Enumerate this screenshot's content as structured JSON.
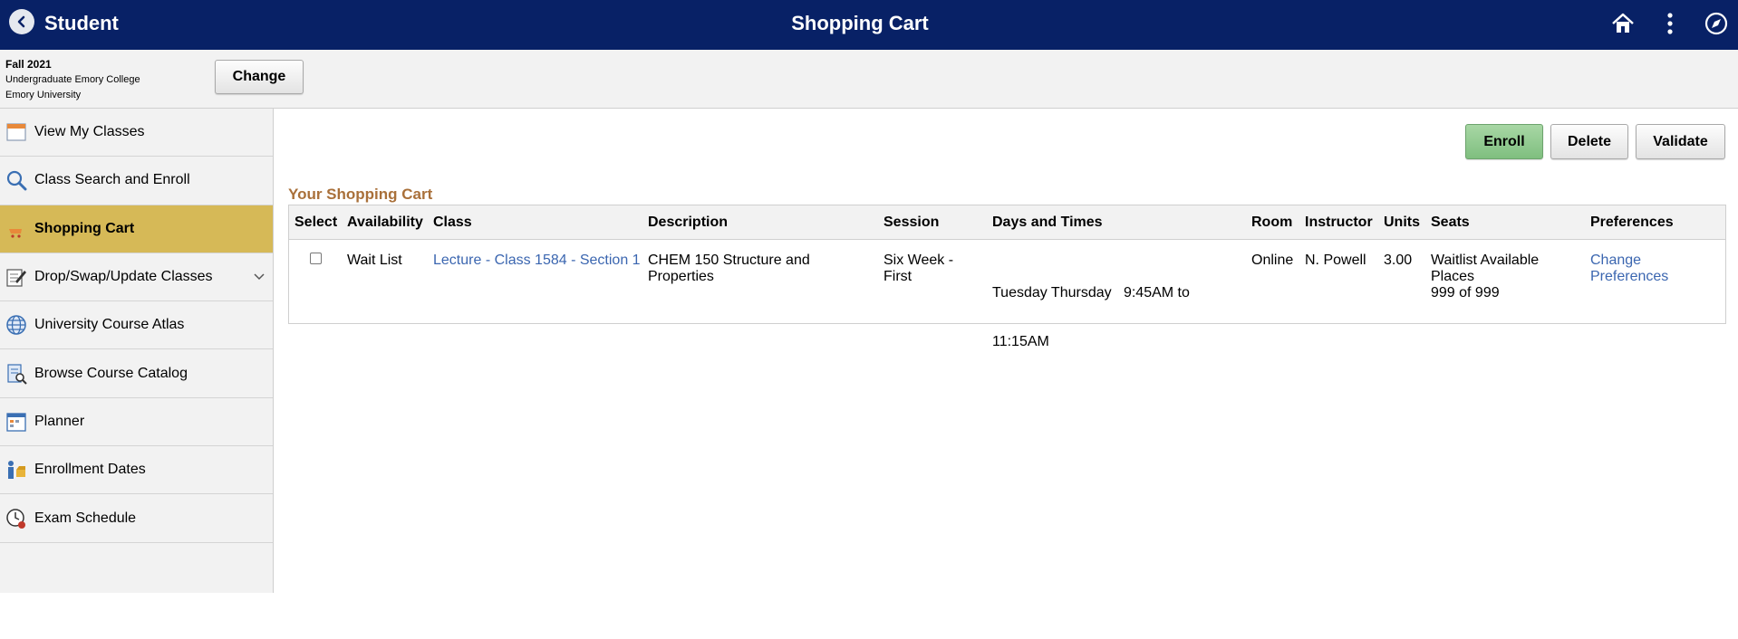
{
  "header": {
    "app_title": "Student",
    "page_title": "Shopping Cart",
    "icons": [
      "chevron-left-icon",
      "home-icon",
      "more-vertical-icon",
      "compass-icon"
    ]
  },
  "context": {
    "term": "Fall 2021",
    "career": "Undergraduate Emory College",
    "institution": "Emory University",
    "change_label": "Change"
  },
  "sidebar": {
    "items": [
      {
        "label": "View My Classes",
        "icon": "calendar-icon"
      },
      {
        "label": "Class Search and Enroll",
        "icon": "search-icon"
      },
      {
        "label": "Shopping Cart",
        "icon": "cart-icon"
      },
      {
        "label": "Drop/Swap/Update Classes",
        "icon": "edit-icon"
      },
      {
        "label": "University Course Atlas",
        "icon": "globe-icon"
      },
      {
        "label": "Browse Course Catalog",
        "icon": "catalog-icon"
      },
      {
        "label": "Planner",
        "icon": "planner-icon"
      },
      {
        "label": "Enrollment Dates",
        "icon": "enrollment-dates-icon"
      },
      {
        "label": "Exam Schedule",
        "icon": "clock-icon"
      }
    ]
  },
  "actions": {
    "enroll": "Enroll",
    "delete": "Delete",
    "validate": "Validate"
  },
  "cart": {
    "title": "Your Shopping Cart",
    "columns": [
      "Select",
      "Availability",
      "Class",
      "Description",
      "Session",
      "Days and Times",
      "Room",
      "Instructor",
      "Units",
      "Seats",
      "Preferences"
    ],
    "rows": [
      {
        "availability": "Wait List",
        "class": "Lecture - Class 1584 - Section 1",
        "description_1": "CHEM 150 Structure and",
        "description_2": "Properties",
        "session_1": "Six Week -",
        "session_2": "First",
        "days_1": "Tuesday Thursday   9:45AM to",
        "days_2": "11:15AM",
        "room": "Online",
        "instructor": "N. Powell",
        "units": "3.00",
        "seats_1": "Waitlist Available",
        "seats_2": "Places",
        "seats_3": "999 of 999",
        "preferences_1": "Change",
        "preferences_2": "Preferences"
      }
    ]
  },
  "colors": {
    "header_bg": "#082166",
    "active_item_bg": "#d6b957",
    "cart_title": "#a9703a",
    "link": "#3b66b0",
    "enroll_button": "#8fca8c"
  }
}
